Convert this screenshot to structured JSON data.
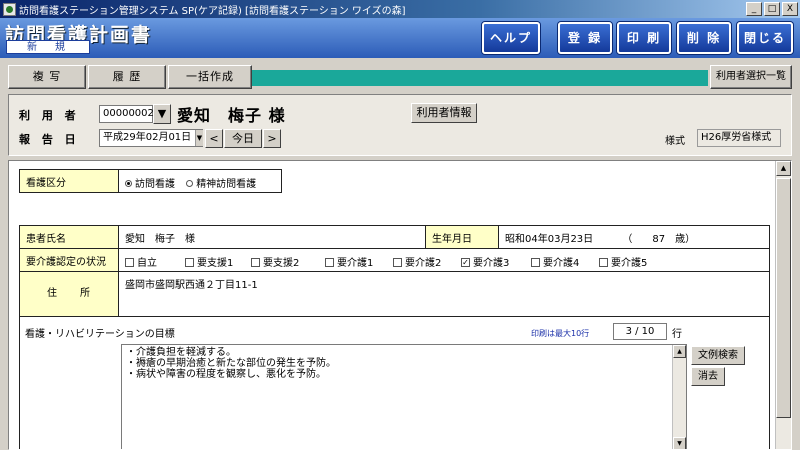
{
  "window": {
    "title": "訪問看護ステーション管理システム SP(ケア記録) [訪問看護ステーション ワイズの森]",
    "minimize": "_",
    "maximize": "□",
    "close": "X"
  },
  "header": {
    "title": "訪問看護計画書",
    "mode_badge": "新　規",
    "buttons": {
      "help": "ヘルプ",
      "register": "登 録",
      "print": "印 刷",
      "delete": "削 除",
      "close": "閉じる"
    }
  },
  "toolbar": {
    "copy": "複 写",
    "history": "履 歴",
    "bulk_create": "一括作成",
    "user_list": "利用者選択一覧"
  },
  "info": {
    "user_label": "利 用 者",
    "user_id": "00000002",
    "user_name": "愛知　梅子 様",
    "user_info_button": "利用者情報",
    "report_date_label": "報 告 日",
    "report_date": "平成29年02月01日",
    "prev": "<",
    "today": "今日",
    "next": ">",
    "style_label": "様式",
    "style_value": "H26厚労省様式"
  },
  "form": {
    "nursing_type_label": "看護区分",
    "nursing_type_options": [
      "訪問看護",
      "精神訪問看護"
    ],
    "nursing_type_selected": "訪問看護",
    "patient_name_label": "患者氏名",
    "patient_name": "愛知　梅子　様",
    "birth_label": "生年月日",
    "birth_date": "昭和04年03月23日",
    "age": "（　　87　歳）",
    "care_level_label": "要介護認定の状況",
    "care_levels": [
      "自立",
      "要支援1",
      "要支援2",
      "要介護1",
      "要介護2",
      "要介護3",
      "要介護4",
      "要介護5"
    ],
    "care_level_selected": "要介護3",
    "address_label": "住　　所",
    "address": "盛岡市盛岡駅西通２丁目11-1",
    "goal_label": "看護・リハビリテーションの目標",
    "print_limit_note": "印刷は最大10行",
    "line_count": "3 / 10",
    "line_unit": "行",
    "goal_lines": [
      "・介護負担を軽減する。",
      "・褥瘡の早期治癒と新たな部位の発生を予防。",
      "・病状や障害の程度を観察し、悪化を予防。"
    ],
    "example_search_button": "文例検索",
    "clear_button": "消去"
  }
}
